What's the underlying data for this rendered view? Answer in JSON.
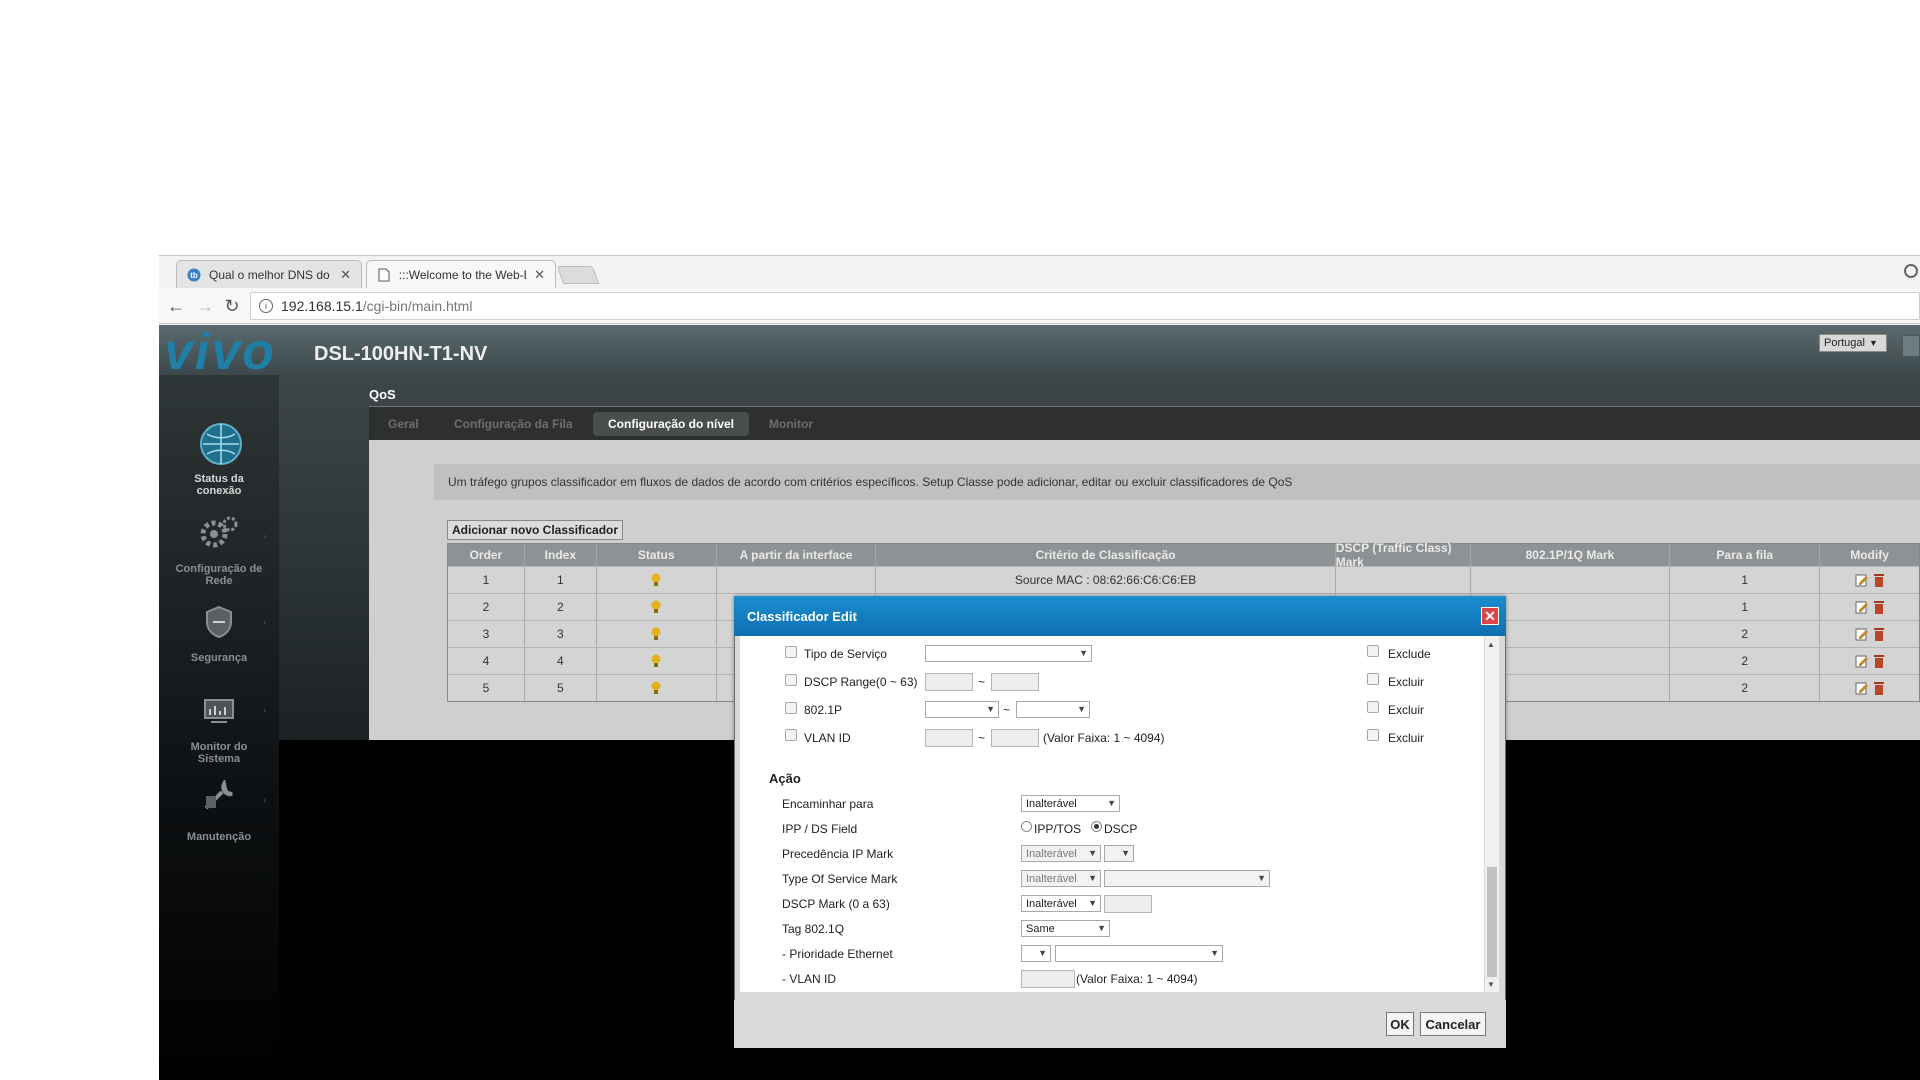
{
  "browser": {
    "tabs": [
      {
        "title": "Qual o melhor DNS do B",
        "icon": "dns-site-icon"
      },
      {
        "title": ":::Welcome to the Web-B",
        "icon": "page-icon"
      }
    ],
    "url_host": "192.168.15.1",
    "url_path": "/cgi-bin/main.html"
  },
  "router": {
    "logo": "vivo",
    "model": "DSL-100HN-T1-NV",
    "language": "Portugal",
    "sidebar": [
      {
        "label_line1": "Status da",
        "label_line2": "conexão",
        "icon": "globe-icon"
      },
      {
        "label_line1": "Configuração de",
        "label_line2": "Rede",
        "icon": "gears-icon"
      },
      {
        "label_line1": "Segurança",
        "label_line2": "",
        "icon": "shield-icon"
      },
      {
        "label_line1": "Monitor do",
        "label_line2": "Sistema",
        "icon": "monitor-icon"
      },
      {
        "label_line1": "Manutenção",
        "label_line2": "",
        "icon": "wrench-icon"
      }
    ],
    "section_title": "QoS",
    "tabs": [
      "Geral",
      "Configuração da Fila",
      "Configuração do nível",
      "Monitor"
    ],
    "description": "Um tráfego grupos classificador em fluxos de dados de acordo com critérios específicos. Setup Classe pode adicionar, editar ou excluir classificadores de QoS",
    "add_button": "Adicionar novo Classificador",
    "table": {
      "headers": [
        "Order",
        "Index",
        "Status",
        "A partir da interface",
        "Critério de Classificação",
        "DSCP (Traffic Class) Mark",
        "802.1P/1Q Mark",
        "Para a fila",
        "Modify"
      ],
      "rows": [
        {
          "order": "1",
          "index": "1",
          "criteria": "Source MAC : 08:62:66:C6:C6:EB",
          "queue": "1"
        },
        {
          "order": "2",
          "index": "2",
          "criteria": "",
          "queue": "1"
        },
        {
          "order": "3",
          "index": "3",
          "criteria": "",
          "queue": "2"
        },
        {
          "order": "4",
          "index": "4",
          "criteria": "",
          "queue": "2"
        },
        {
          "order": "5",
          "index": "5",
          "criteria": "",
          "queue": "2"
        }
      ]
    }
  },
  "dialog": {
    "title": "Classificador Edit",
    "criteria": {
      "tos_label": "Tipo de Serviço",
      "tos_exclude": "Exclude",
      "dscp_label": "DSCP Range(0 ~ 63)",
      "dscp_exclude": "Excluir",
      "p8021_label": "802.1P",
      "p8021_exclude": "Excluir",
      "vlan_label": "VLAN ID",
      "vlan_hint": "(Valor Faixa: 1 ~ 4094)",
      "vlan_exclude": "Excluir",
      "tilde": "~"
    },
    "action": {
      "title": "Ação",
      "forward_label": "Encaminhar para",
      "forward_value": "Inalterável",
      "ippds_label": "IPP / DS Field",
      "ippds_opt1": "IPP/TOS",
      "ippds_opt2": "DSCP",
      "ipprec_label": "Precedência IP Mark",
      "ipprec_value": "Inalterável",
      "tosmark_label": "Type Of Service Mark",
      "tosmark_value": "Inalterável",
      "dscpmark_label": "DSCP Mark (0 a 63)",
      "dscpmark_value": "Inalterável",
      "tag_label": "Tag 802.1Q",
      "tag_value": "Same",
      "eth_label": "- Prioridade Ethernet",
      "vlan_label": "- VLAN ID",
      "vlan_hint": "(Valor Faixa: 1 ~ 4094)"
    },
    "ok_label": "OK",
    "cancel_label": "Cancelar"
  },
  "colors": {
    "title_bar": "#1a8ed0",
    "close_button": "#e04343",
    "logo": "#1f7fa6"
  }
}
